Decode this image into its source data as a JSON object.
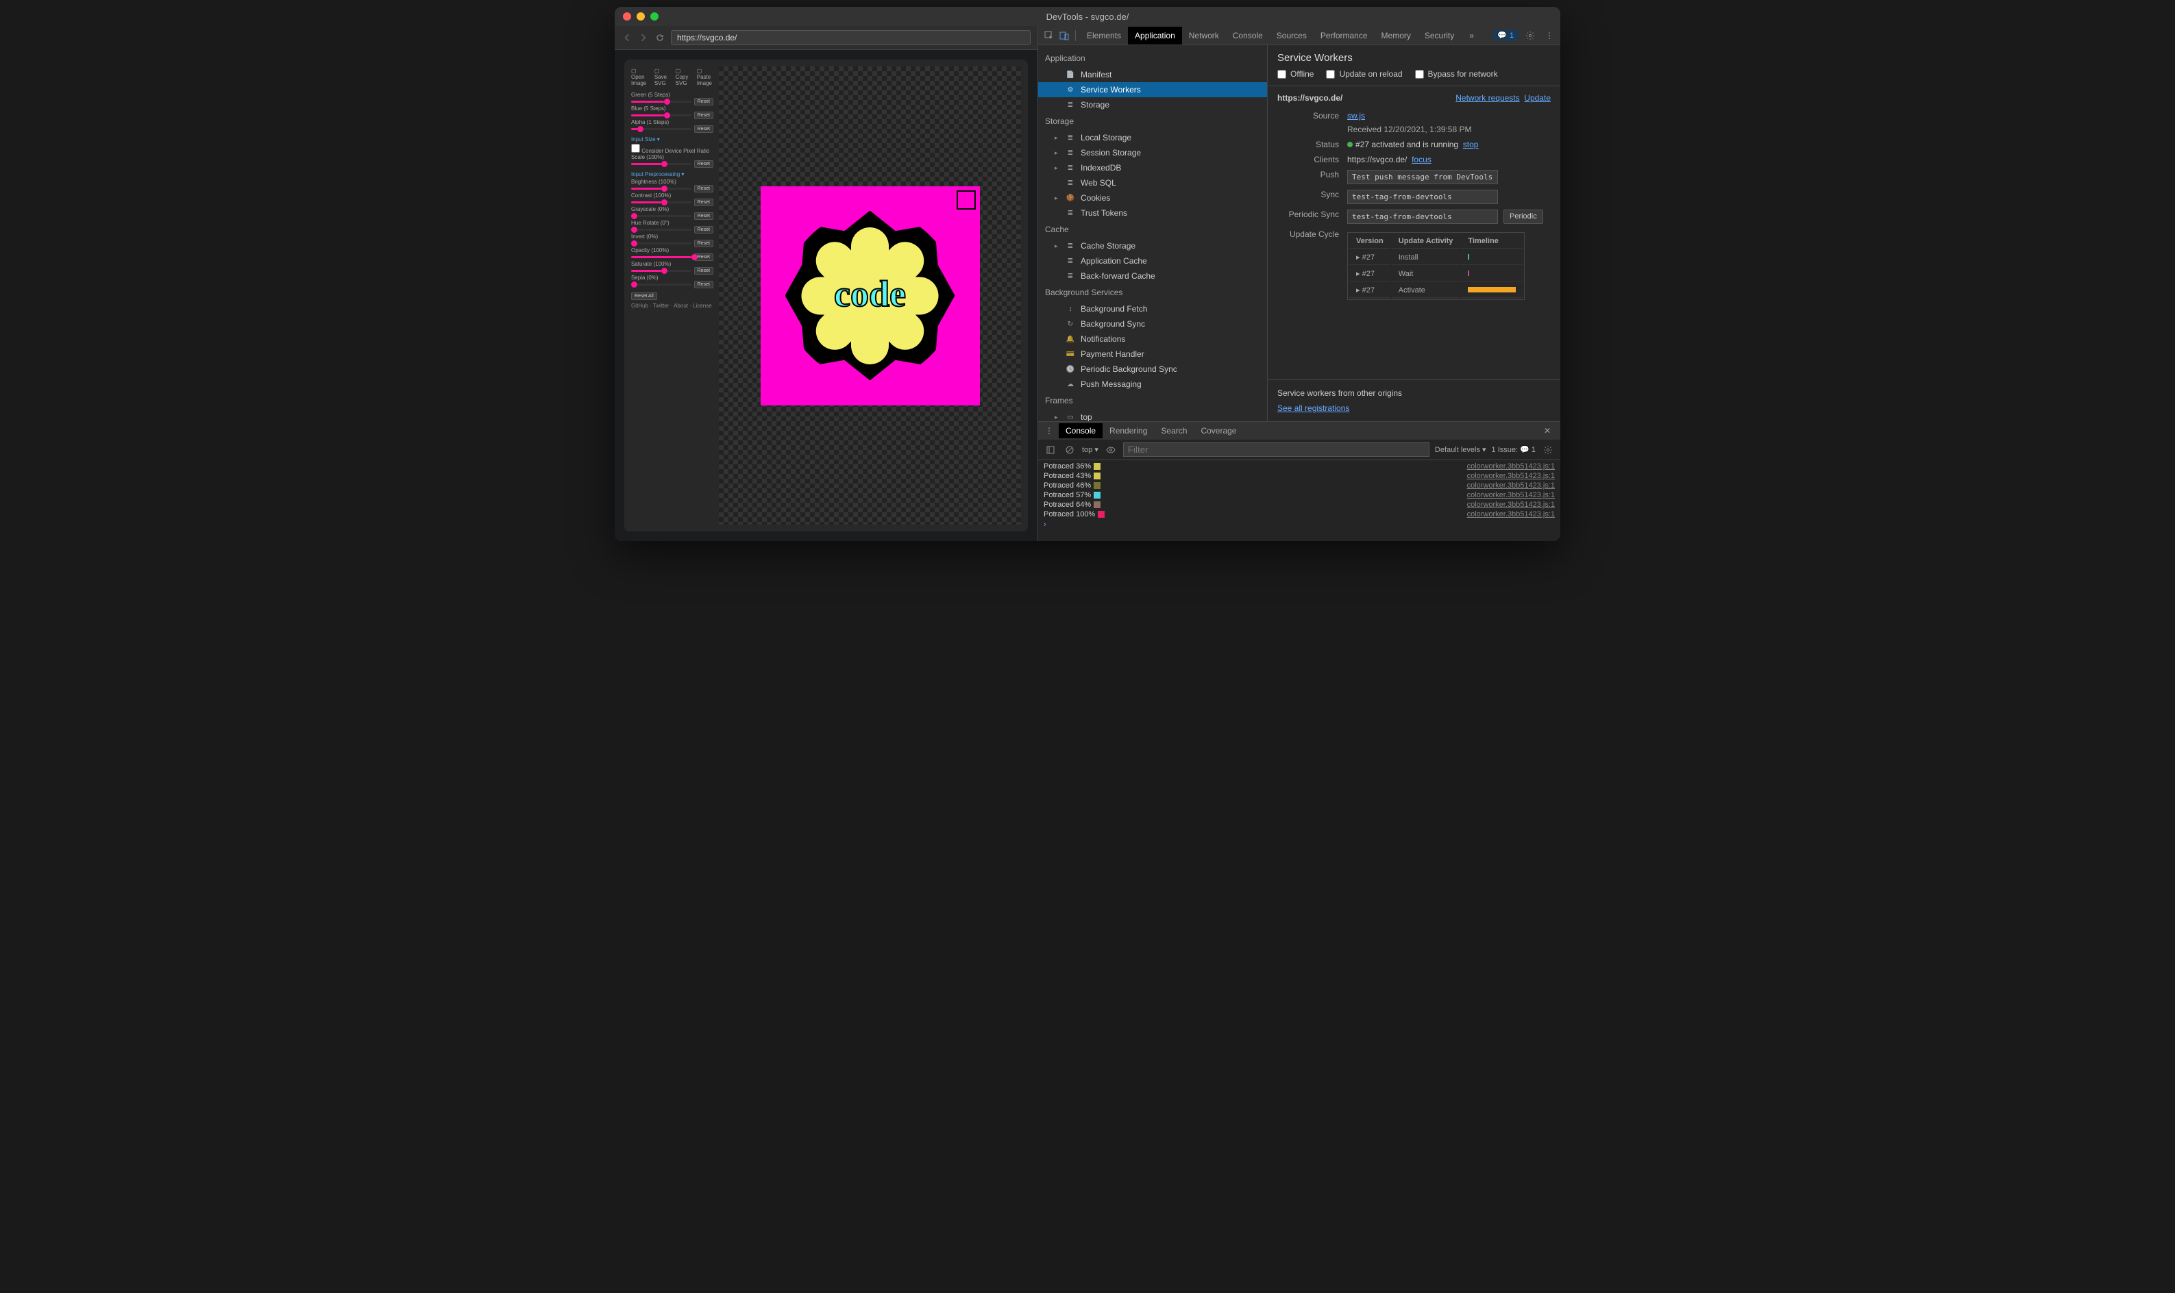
{
  "window": {
    "title": "DevTools - svgco.de/"
  },
  "address": {
    "url": "https://svgco.de/"
  },
  "page": {
    "toolbar": [
      "Open Image",
      "Save SVG",
      "Copy SVG",
      "Paste Image"
    ],
    "sliders": [
      {
        "label": "Green (5 Steps)",
        "pct": 55
      },
      {
        "label": "Blue (5 Steps)",
        "pct": 55
      },
      {
        "label": "Alpha (1 Steps)",
        "pct": 10
      }
    ],
    "section_input": "Input Size ▾",
    "input_items": [
      {
        "label": "Consider Device Pixel Ratio",
        "type": "check"
      },
      {
        "label": "Scale (100%)",
        "pct": 50
      }
    ],
    "section_pre": "Input Preprocessing ▾",
    "pre_items": [
      {
        "label": "Brightness (100%)",
        "pct": 50
      },
      {
        "label": "Contrast (100%)",
        "pct": 50
      },
      {
        "label": "Grayscale (0%)",
        "pct": 0
      },
      {
        "label": "Hue Rotate (0°)",
        "pct": 0
      },
      {
        "label": "Invert (0%)",
        "pct": 0
      },
      {
        "label": "Opacity (100%)",
        "pct": 100
      },
      {
        "label": "Saturate (100%)",
        "pct": 50
      },
      {
        "label": "Sepia (0%)",
        "pct": 0
      }
    ],
    "reset_btn": "Reset",
    "reset_all": "Reset All",
    "footer": "GitHub · Twitter · About · License",
    "logo_text": "code"
  },
  "devtools": {
    "tabs": [
      "Elements",
      "Application",
      "Network",
      "Console",
      "Sources",
      "Performance",
      "Memory",
      "Security"
    ],
    "active_tab": "Application",
    "more": "»",
    "issue_count": "1"
  },
  "app_nav": {
    "groups": [
      {
        "title": "Application",
        "items": [
          {
            "label": "Manifest",
            "icon": "file"
          },
          {
            "label": "Service Workers",
            "icon": "gear",
            "selected": true
          },
          {
            "label": "Storage",
            "icon": "db"
          }
        ]
      },
      {
        "title": "Storage",
        "items": [
          {
            "label": "Local Storage",
            "icon": "db",
            "expand": true
          },
          {
            "label": "Session Storage",
            "icon": "db",
            "expand": true
          },
          {
            "label": "IndexedDB",
            "icon": "db",
            "expand": true
          },
          {
            "label": "Web SQL",
            "icon": "db"
          },
          {
            "label": "Cookies",
            "icon": "cookie",
            "expand": true
          },
          {
            "label": "Trust Tokens",
            "icon": "db"
          }
        ]
      },
      {
        "title": "Cache",
        "items": [
          {
            "label": "Cache Storage",
            "icon": "db",
            "expand": true
          },
          {
            "label": "Application Cache",
            "icon": "db"
          },
          {
            "label": "Back-forward Cache",
            "icon": "db"
          }
        ]
      },
      {
        "title": "Background Services",
        "items": [
          {
            "label": "Background Fetch",
            "icon": "updown"
          },
          {
            "label": "Background Sync",
            "icon": "sync"
          },
          {
            "label": "Notifications",
            "icon": "bell"
          },
          {
            "label": "Payment Handler",
            "icon": "card"
          },
          {
            "label": "Periodic Background Sync",
            "icon": "clock"
          },
          {
            "label": "Push Messaging",
            "icon": "cloud"
          }
        ]
      },
      {
        "title": "Frames",
        "items": [
          {
            "label": "top",
            "icon": "frame",
            "expand": true
          }
        ]
      }
    ]
  },
  "sw": {
    "title": "Service Workers",
    "checks": [
      "Offline",
      "Update on reload",
      "Bypass for network"
    ],
    "origin": "https://svgco.de/",
    "network_requests": "Network requests",
    "update": "Update",
    "rows": {
      "source_label": "Source",
      "source_val": "sw.js",
      "received": "Received 12/20/2021, 1:39:58 PM",
      "status_label": "Status",
      "status_val": "#27 activated and is running",
      "stop": "stop",
      "clients_label": "Clients",
      "clients_val": "https://svgco.de/",
      "focus": "focus",
      "push_label": "Push",
      "push_val": "Test push message from DevTools.",
      "sync_label": "Sync",
      "sync_val": "test-tag-from-devtools",
      "psync_label": "Periodic Sync",
      "psync_val": "test-tag-from-devtools",
      "psync_btn": "Periodic",
      "cycle_label": "Update Cycle"
    },
    "cycle": {
      "headers": [
        "Version",
        "Update Activity",
        "Timeline"
      ],
      "rows": [
        {
          "v": "#27",
          "a": "Install",
          "color": "#4db6ac",
          "w": 2
        },
        {
          "v": "#27",
          "a": "Wait",
          "color": "#c24b9a",
          "w": 2
        },
        {
          "v": "#27",
          "a": "Activate",
          "color": "#f5a623",
          "w": 70
        }
      ]
    },
    "other_title": "Service workers from other origins",
    "other_link": "See all registrations"
  },
  "drawer": {
    "tabs": [
      "Console",
      "Rendering",
      "Search",
      "Coverage"
    ],
    "active": "Console",
    "context": "top",
    "filter_ph": "Filter",
    "levels": "Default levels",
    "issues": "1 Issue:",
    "issues_count": "1",
    "logs": [
      {
        "msg": "Potraced 36%",
        "color": "#d4c94e",
        "src": "colorworker.3bb51423.js:1"
      },
      {
        "msg": "Potraced 43%",
        "color": "#d4c94e",
        "src": "colorworker.3bb51423.js:1"
      },
      {
        "msg": "Potraced 46%",
        "color": "#7a7330",
        "src": "colorworker.3bb51423.js:1"
      },
      {
        "msg": "Potraced 57%",
        "color": "#4dd0e1",
        "src": "colorworker.3bb51423.js:1"
      },
      {
        "msg": "Potraced 64%",
        "color": "#8d6e63",
        "src": "colorworker.3bb51423.js:1"
      },
      {
        "msg": "Potraced 100%",
        "color": "#e91e63",
        "src": "colorworker.3bb51423.js:1"
      }
    ]
  }
}
